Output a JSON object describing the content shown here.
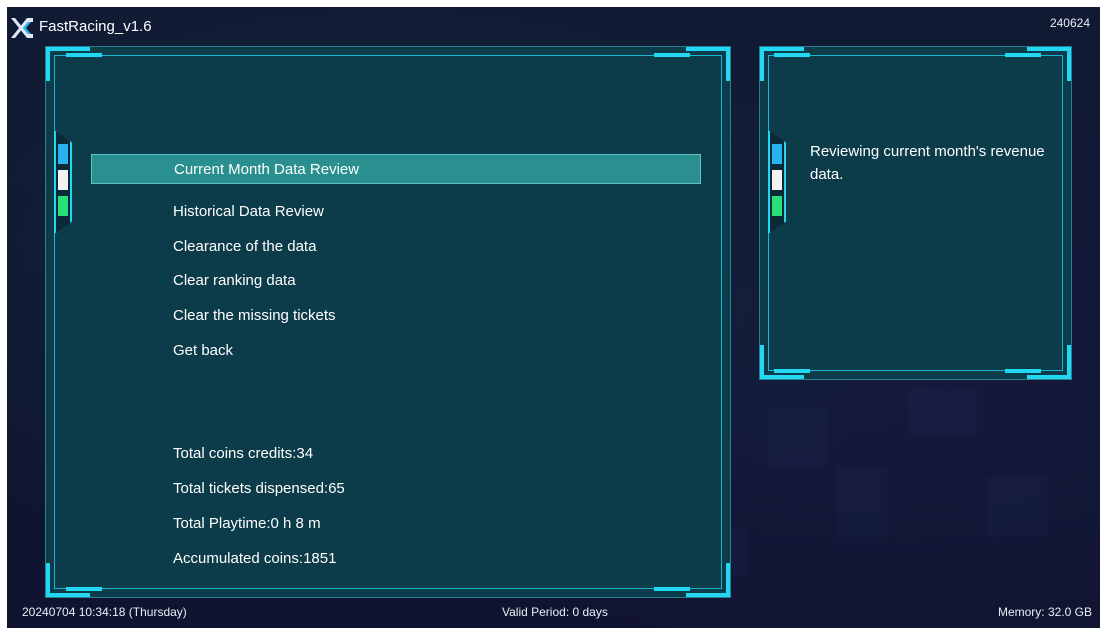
{
  "header": {
    "app_title": "FastRacing_v1.6",
    "build_code": "240624"
  },
  "menu": {
    "items": [
      {
        "label": "Current Month Data Review",
        "selected": true
      },
      {
        "label": "Historical Data Review",
        "selected": false
      },
      {
        "label": "Clearance of the data",
        "selected": false
      },
      {
        "label": "Clear ranking data",
        "selected": false
      },
      {
        "label": "Clear the missing tickets",
        "selected": false
      },
      {
        "label": "Get back",
        "selected": false
      }
    ]
  },
  "stats": {
    "coins_credits": "Total coins credits:34",
    "tickets_dispensed": "Total tickets dispensed:65",
    "playtime": "Total Playtime:0 h 8 m",
    "accumulated_coins": "Accumulated coins:1851"
  },
  "info_panel": {
    "description": "Reviewing current month's revenue data."
  },
  "side_tabs": {
    "colors": [
      "#2bb3f0",
      "#f2f2f2",
      "#27e07a"
    ]
  },
  "footer": {
    "datetime": "20240704 10:34:18 (Thursday)",
    "valid_period": "Valid Period: 0 days",
    "memory": "Memory: 32.0 GB"
  },
  "colors": {
    "accent": "#22d7f2",
    "panel_bg": "#0c3b4a",
    "selected_bg": "#2a8f8f"
  }
}
